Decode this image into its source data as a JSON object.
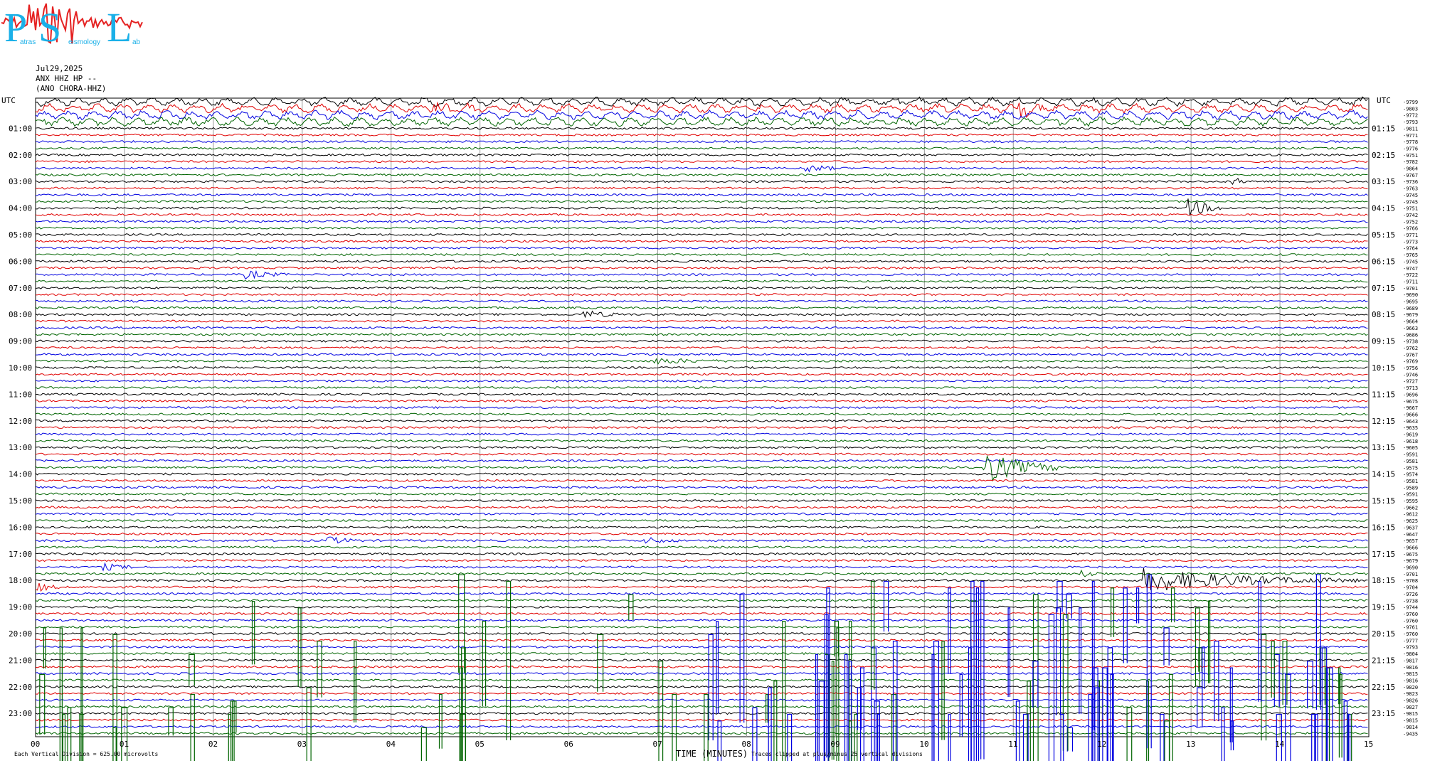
{
  "logo": {
    "letters": [
      "P",
      "S",
      "L"
    ],
    "small_text": [
      "atras",
      "eismology",
      "ab"
    ],
    "colors": {
      "letters": "#1ab0e8",
      "wave": "#e52222"
    }
  },
  "header": {
    "date": "Jul29,2025",
    "station": "ANX HHZ HP --",
    "network": "(ANO CHORA-HHZ)"
  },
  "axis": {
    "left_corner_label": "UTC",
    "right_corner_label": "UTC",
    "left_hour_labels": [
      "01:00",
      "02:00",
      "03:00",
      "04:00",
      "05:00",
      "06:00",
      "07:00",
      "08:00",
      "09:00",
      "10:00",
      "11:00",
      "12:00",
      "13:00",
      "14:00",
      "15:00",
      "16:00",
      "17:00",
      "18:00",
      "19:00",
      "20:00",
      "21:00",
      "22:00",
      "23:00"
    ],
    "right_hour_labels": [
      "01:15",
      "02:15",
      "03:15",
      "04:15",
      "05:15",
      "06:15",
      "07:15",
      "08:15",
      "09:15",
      "10:15",
      "11:15",
      "12:15",
      "13:15",
      "14:15",
      "15:15",
      "16:15",
      "17:15",
      "18:15",
      "19:15",
      "20:15",
      "21:15",
      "22:15",
      "23:15"
    ],
    "minute_labels": [
      "00",
      "01",
      "02",
      "03",
      "04",
      "05",
      "06",
      "07",
      "08",
      "09",
      "10",
      "11",
      "12",
      "13",
      "14",
      "15"
    ]
  },
  "footer": {
    "division_note": "Each Vertical Division = 625.00 microvolts",
    "xaxis_title": "TIME (MINUTES)",
    "clip_note": "Traces clipped at plus/minus 25 vertical divisions"
  },
  "chart_data": {
    "type": "line",
    "title": "",
    "xlabel": "TIME (MINUTES)",
    "ylabel": "UTC",
    "xlim": [
      0,
      15
    ],
    "rows_per_hour": 4,
    "hours": 24,
    "trace_colors": [
      "#000000",
      "#e00000",
      "#0000e0",
      "#006400"
    ],
    "row_values": [
      -9799,
      -9803,
      -9772,
      -9793,
      -9811,
      -9771,
      -9778,
      -9776,
      -9751,
      -9782,
      -9864,
      -9767,
      -9736,
      -9763,
      -9745,
      -9745,
      -9751,
      -9742,
      -9752,
      -9766,
      -9771,
      -9773,
      -9764,
      -9765,
      -9745,
      -9747,
      -9722,
      -9711,
      -9701,
      -9690,
      -9695,
      -9689,
      -9679,
      -9664,
      -9663,
      -9686,
      -9738,
      -9762,
      -9767,
      -9769,
      -9756,
      -9746,
      -9727,
      -9713,
      -9696,
      -9675,
      -9667,
      -9666,
      -9643,
      -9635,
      -9619,
      -9618,
      -9605,
      -9591,
      -9581,
      -9575,
      -9574,
      -9581,
      -9589,
      -9591,
      -9595,
      -9662,
      -9612,
      -9625,
      -9637,
      -9647,
      -9657,
      -9666,
      -9675,
      -9679,
      -9690,
      -9701,
      -9708,
      -9704,
      -9726,
      -9738,
      -9744,
      -9760,
      -9760,
      -9761,
      -9760,
      -9777,
      -9793,
      -9804,
      -9817,
      -9816,
      -9815,
      -9816,
      -9820,
      -9823,
      -9826,
      -9827,
      -9815,
      -9815,
      -9814,
      -9435
    ],
    "events": [
      {
        "row": 1,
        "minute": 4.5,
        "amplitude": 6,
        "duration": 0.6
      },
      {
        "row": 1,
        "minute": 11.1,
        "amplitude": 8,
        "duration": 0.4
      },
      {
        "row": 10,
        "minute": 8.7,
        "amplitude": 5,
        "duration": 0.4
      },
      {
        "row": 12,
        "minute": 13.5,
        "amplitude": 4,
        "duration": 0.2
      },
      {
        "row": 16,
        "minute": 13.0,
        "amplitude": 12,
        "duration": 0.4
      },
      {
        "row": 26,
        "minute": 2.4,
        "amplitude": 5,
        "duration": 0.5
      },
      {
        "row": 32,
        "minute": 6.2,
        "amplitude": 5,
        "duration": 0.5
      },
      {
        "row": 39,
        "minute": 7.0,
        "amplitude": 4,
        "duration": 0.8
      },
      {
        "row": 55,
        "minute": 10.7,
        "amplitude": 22,
        "duration": 0.9
      },
      {
        "row": 66,
        "minute": 3.3,
        "amplitude": 5,
        "duration": 0.4
      },
      {
        "row": 66,
        "minute": 6.9,
        "amplitude": 4,
        "duration": 0.4
      },
      {
        "row": 70,
        "minute": 0.8,
        "amplitude": 4,
        "duration": 0.4
      },
      {
        "row": 71,
        "minute": 11.8,
        "amplitude": 4,
        "duration": 0.3
      },
      {
        "row": 73,
        "minute": 0.0,
        "amplitude": 7,
        "duration": 0.3
      },
      {
        "row": 72,
        "minute": 12.5,
        "amplitude": 16,
        "duration": 2.4
      }
    ],
    "clipped_period": {
      "start_row": 72,
      "end_row": 95,
      "clip_divisions": 25
    }
  }
}
